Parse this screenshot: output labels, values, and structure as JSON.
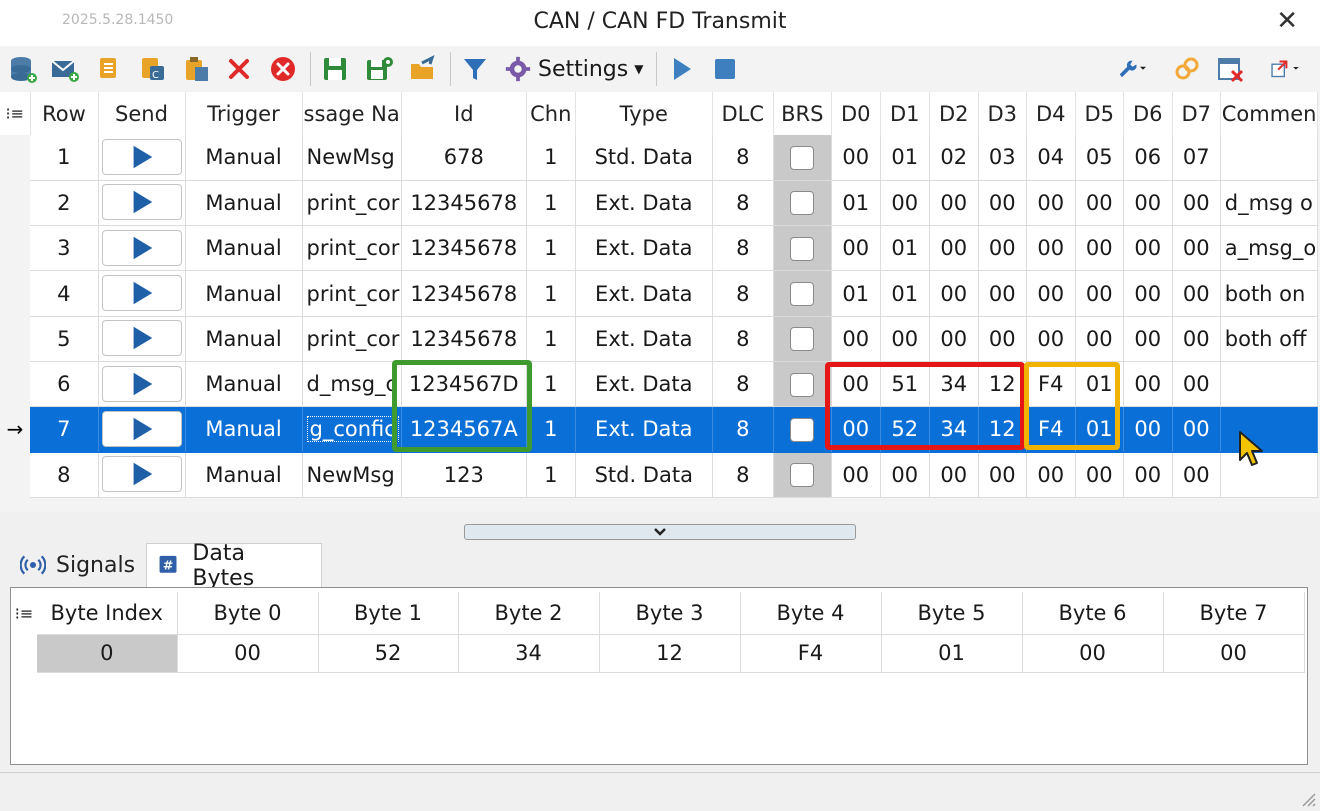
{
  "window": {
    "version": "2025.5.28.1450",
    "title": "CAN / CAN FD Transmit",
    "close_glyph": "✕"
  },
  "toolbar": {
    "settings_label": "Settings",
    "icons": [
      "database-add-icon",
      "mail-add-icon",
      "copy-icon",
      "copy-special-icon",
      "paste-icon",
      "delete-icon",
      "delete-all-icon",
      "save-icon",
      "save-as-icon",
      "open-folder-icon",
      "filter-icon",
      "gear-icon",
      "play-icon",
      "stop-icon",
      "wrench-icon",
      "link-icon",
      "window-close-icon",
      "export-icon"
    ]
  },
  "grid": {
    "headers": [
      "Row",
      "Send",
      "Trigger",
      "ssage Na",
      "Id",
      "Chn",
      "Type",
      "DLC",
      "BRS",
      "D0",
      "D1",
      "D2",
      "D3",
      "D4",
      "D5",
      "D6",
      "D7",
      "Commen"
    ],
    "rows": [
      {
        "row": "1",
        "trigger": "Manual",
        "name": "NewMsg",
        "id": "678",
        "chn": "1",
        "type": "Std. Data",
        "dlc": "8",
        "d": [
          "00",
          "01",
          "02",
          "03",
          "04",
          "05",
          "06",
          "07"
        ],
        "comment": ""
      },
      {
        "row": "2",
        "trigger": "Manual",
        "name": "print_cor",
        "id": "12345678",
        "chn": "1",
        "type": "Ext. Data",
        "dlc": "8",
        "d": [
          "01",
          "00",
          "00",
          "00",
          "00",
          "00",
          "00",
          "00"
        ],
        "comment": "d_msg o"
      },
      {
        "row": "3",
        "trigger": "Manual",
        "name": "print_cor",
        "id": "12345678",
        "chn": "1",
        "type": "Ext. Data",
        "dlc": "8",
        "d": [
          "00",
          "01",
          "00",
          "00",
          "00",
          "00",
          "00",
          "00"
        ],
        "comment": "a_msg_o"
      },
      {
        "row": "4",
        "trigger": "Manual",
        "name": "print_cor",
        "id": "12345678",
        "chn": "1",
        "type": "Ext. Data",
        "dlc": "8",
        "d": [
          "01",
          "01",
          "00",
          "00",
          "00",
          "00",
          "00",
          "00"
        ],
        "comment": "both on"
      },
      {
        "row": "5",
        "trigger": "Manual",
        "name": "print_cor",
        "id": "12345678",
        "chn": "1",
        "type": "Ext. Data",
        "dlc": "8",
        "d": [
          "00",
          "00",
          "00",
          "00",
          "00",
          "00",
          "00",
          "00"
        ],
        "comment": "both off"
      },
      {
        "row": "6",
        "trigger": "Manual",
        "name": "d_msg_c",
        "id": "1234567D",
        "chn": "1",
        "type": "Ext. Data",
        "dlc": "8",
        "d": [
          "00",
          "51",
          "34",
          "12",
          "F4",
          "01",
          "00",
          "00"
        ],
        "comment": ""
      },
      {
        "row": "7",
        "trigger": "Manual",
        "name": "g_confic",
        "id": "1234567A",
        "chn": "1",
        "type": "Ext. Data",
        "dlc": "8",
        "d": [
          "00",
          "52",
          "34",
          "12",
          "F4",
          "01",
          "00",
          "00"
        ],
        "comment": ""
      },
      {
        "row": "8",
        "trigger": "Manual",
        "name": "NewMsg",
        "id": "123",
        "chn": "1",
        "type": "Std. Data",
        "dlc": "8",
        "d": [
          "00",
          "00",
          "00",
          "00",
          "00",
          "00",
          "00",
          "00"
        ],
        "comment": ""
      }
    ],
    "current_row_marker": "→"
  },
  "tabs": {
    "signals": "Signals",
    "data_bytes": "Data Bytes",
    "active": "data_bytes"
  },
  "bytes": {
    "headers": [
      "Byte Index",
      "Byte 0",
      "Byte 1",
      "Byte 2",
      "Byte 3",
      "Byte 4",
      "Byte 5",
      "Byte 6",
      "Byte 7"
    ],
    "row": [
      "0",
      "00",
      "52",
      "34",
      "12",
      "F4",
      "01",
      "00",
      "00"
    ]
  },
  "colors": {
    "selection": "#0a6fd6",
    "highlight_green": "#3f9b2f",
    "highlight_red": "#e51616",
    "highlight_orange": "#f0b400",
    "play_blue": "#1f5fa8"
  }
}
